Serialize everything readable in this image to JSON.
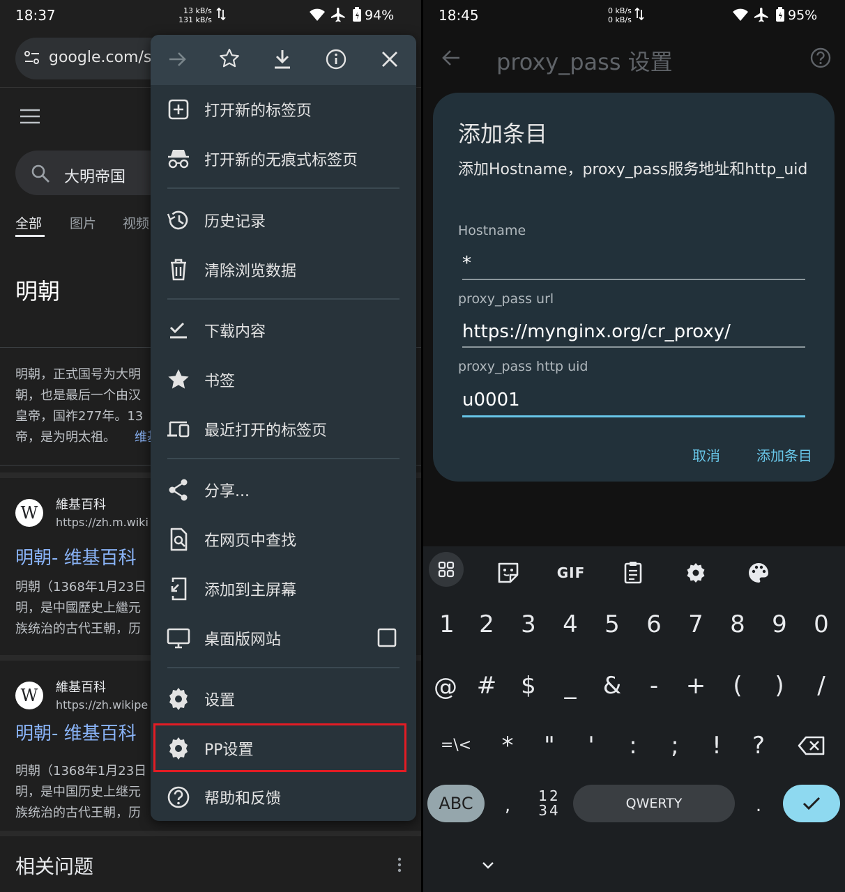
{
  "left": {
    "status": {
      "time": "18:37",
      "net_up": "13 kB/s",
      "net_down": "131 kB/s",
      "battery": "94%"
    },
    "url": "google.com/s",
    "search_query": "大明帝国",
    "tabs": [
      "全部",
      "图片",
      "视频"
    ],
    "knowledge_title": "明朝",
    "knowledge_lines": [
      "明朝，正式国号为大明",
      "朝，也是最后一个由汉",
      "皇帝，国祚277年。13",
      "帝，是为明太祖。"
    ],
    "knowledge_more": "维基",
    "results": [
      {
        "logo": "W",
        "site": "維基百科",
        "url": "https://zh.m.wiki",
        "title": "明朝- 维基百科",
        "snippet": [
          "明朝（1368年1月23日",
          "明，是中國歷史上繼元",
          "族统治的古代王朝，历"
        ]
      },
      {
        "logo": "W",
        "site": "維基百科",
        "url": "https://zh.wikipe",
        "title": "明朝- 维基百科",
        "snippet": [
          "明朝（1368年1月23日",
          "明，是中国历史上继元",
          "族统治的古代王朝，历"
        ]
      }
    ],
    "related_title": "相关问题",
    "menu": {
      "toolbar": [
        "forward-icon",
        "bookmark-star-icon",
        "download-icon",
        "info-icon",
        "close-icon"
      ],
      "items": [
        {
          "label": "打开新的标签页",
          "icon": "new-tab-icon"
        },
        {
          "label": "打开新的无痕式标签页",
          "icon": "incognito-icon"
        },
        {
          "label": "历史记录",
          "icon": "history-icon"
        },
        {
          "label": "清除浏览数据",
          "icon": "trash-icon"
        },
        {
          "label": "下载内容",
          "icon": "download-done-icon"
        },
        {
          "label": "书签",
          "icon": "star-icon"
        },
        {
          "label": "最近打开的标签页",
          "icon": "devices-icon"
        },
        {
          "label": "分享...",
          "icon": "share-icon"
        },
        {
          "label": "在网页中查找",
          "icon": "find-in-page-icon"
        },
        {
          "label": "添加到主屏幕",
          "icon": "add-to-home-icon"
        },
        {
          "label": "桌面版网站",
          "icon": "desktop-icon"
        },
        {
          "label": "设置",
          "icon": "gear-icon"
        },
        {
          "label": "PP设置",
          "icon": "gear-icon"
        },
        {
          "label": "帮助和反馈",
          "icon": "help-icon"
        }
      ],
      "highlight_color": "#e31c24"
    }
  },
  "right": {
    "status": {
      "time": "18:45",
      "net_up": "0 kB/s",
      "net_down": "0 kB/s",
      "battery": "95%"
    },
    "toolbar_title": "proxy_pass 设置",
    "dialog": {
      "title": "添加条目",
      "subtitle": "添加Hostname，proxy_pass服务地址和http_uid",
      "fields": [
        {
          "label": "Hostname",
          "value": "*"
        },
        {
          "label": "proxy_pass url",
          "value": "https://mynginx.org/cr_proxy/"
        },
        {
          "label": "proxy_pass http uid",
          "value": "u0001"
        }
      ],
      "cancel": "取消",
      "confirm": "添加条目"
    },
    "keyboard": {
      "toolbar": [
        "apps-grid-icon",
        "sticker-icon",
        "gif-icon",
        "clipboard-icon",
        "gear-icon",
        "palette-icon"
      ],
      "gif_label": "GIF",
      "row_digits": [
        "1",
        "2",
        "3",
        "4",
        "5",
        "6",
        "7",
        "8",
        "9",
        "0"
      ],
      "row_symbols": [
        "@",
        "#",
        "$",
        "_",
        "&",
        "-",
        "+",
        "(",
        ")",
        "/"
      ],
      "row_third": [
        "=\\<",
        "*",
        "\"",
        "'",
        ":",
        ";",
        "!",
        "?"
      ],
      "abc": "ABC",
      "comma": ",",
      "numpad_top": "12",
      "numpad_bottom": "34",
      "space_label": "QWERTY",
      "period": ".",
      "accent": "#8ed9f0"
    }
  }
}
